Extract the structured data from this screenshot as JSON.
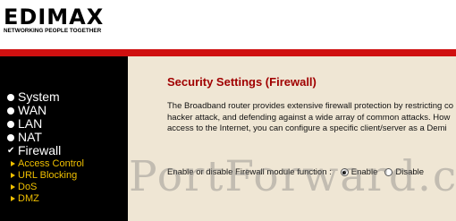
{
  "brand": {
    "logo_text": "EDIMAX",
    "tagline": "NETWORKING PEOPLE TOGETHER"
  },
  "nav": {
    "items": [
      {
        "label": "System",
        "marker": "dot"
      },
      {
        "label": "WAN",
        "marker": "dot"
      },
      {
        "label": "LAN",
        "marker": "dot"
      },
      {
        "label": "NAT",
        "marker": "dot"
      },
      {
        "label": "Firewall",
        "marker": "check"
      }
    ],
    "firewall_sub": [
      {
        "label": "Access Control"
      },
      {
        "label": "URL Blocking"
      },
      {
        "label": "DoS"
      },
      {
        "label": "DMZ"
      }
    ]
  },
  "page": {
    "title": "Security Settings (Firewall)",
    "description_lines": [
      "The Broadband router provides extensive firewall protection by restricting co",
      "hacker attack, and defending against a wide array of common attacks. How",
      "access to the Internet, you can configure a specific client/server as a Demi"
    ]
  },
  "firewall_toggle": {
    "label": "Enable or disable Firewall module function :",
    "options": [
      {
        "label": "Enable",
        "selected": true
      },
      {
        "label": "Disable",
        "selected": false
      }
    ]
  },
  "watermark": "PortForward.com",
  "colors": {
    "accent_red": "#d01010",
    "title_red": "#a00000",
    "sub_nav_yellow": "#f0c000",
    "content_bg": "#efe6d4"
  }
}
